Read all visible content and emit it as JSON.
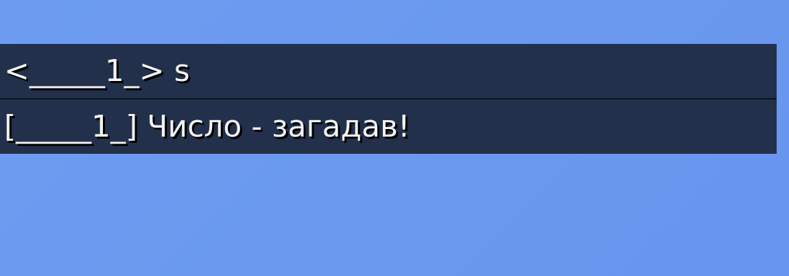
{
  "chat": {
    "lines": [
      {
        "text": "<_____1_> s"
      },
      {
        "text": "[_____1_] Число - загадав!"
      }
    ]
  }
}
